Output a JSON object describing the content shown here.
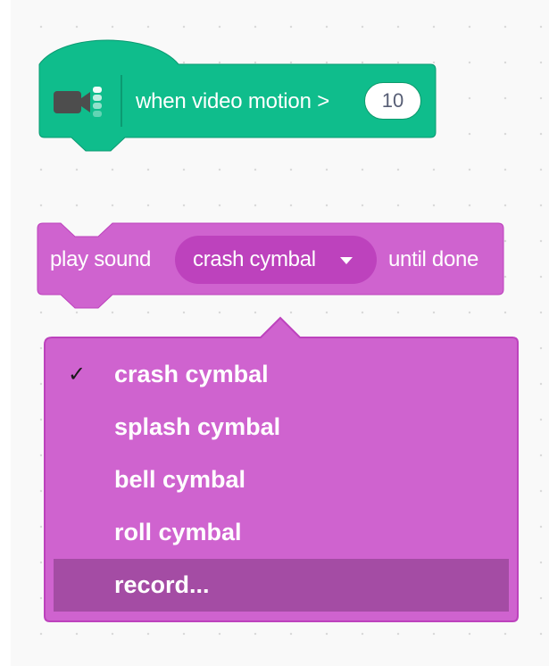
{
  "colors": {
    "workspace_bg": "#f9f9f9",
    "video_block": "#0fbd8c",
    "video_block_border": "#0b9a72",
    "sound_block": "#cf63cf",
    "sound_block_border": "#bd42bd",
    "menu_highlight": "#a44ca4"
  },
  "hat_block": {
    "icon": "video-camera-icon",
    "label": "when video motion >",
    "motion_value": "10"
  },
  "sound_block": {
    "prefix": "play sound",
    "selected_sound": "crash cymbal",
    "suffix": "until done"
  },
  "dropdown": {
    "check_mark": "✓",
    "items": [
      {
        "label": "crash cymbal",
        "checked": true
      },
      {
        "label": "splash cymbal",
        "checked": false
      },
      {
        "label": "bell cymbal",
        "checked": false
      },
      {
        "label": "roll cymbal",
        "checked": false
      },
      {
        "label": "record...",
        "checked": false,
        "highlighted": true
      }
    ]
  }
}
